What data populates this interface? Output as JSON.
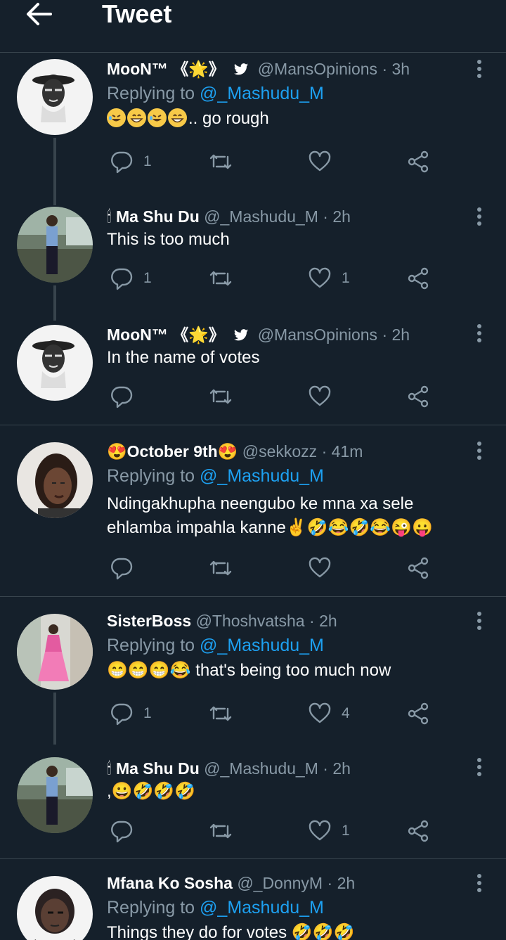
{
  "header": {
    "title": "Tweet"
  },
  "tweets": [
    {
      "name": "MooN™ 《🌟》",
      "handle": "@MansOpinions",
      "dot": "·",
      "time": "3h",
      "verified_bird": true,
      "replying_prefix": "Replying to ",
      "replying_to": "@_Mashudu_M",
      "text_suffix": ".. go rough",
      "emojis": [
        "rofl",
        "grin",
        "rofl",
        "grin"
      ],
      "reply_count": "1",
      "retweet_count": "",
      "like_count": ""
    },
    {
      "name_prefix": "🕯",
      "name": "Ma Shu Du",
      "handle": "@_Mashudu_M",
      "dot": "·",
      "time": "2h",
      "text": "This is too much",
      "reply_count": "1",
      "retweet_count": "",
      "like_count": "1"
    },
    {
      "name": "MooN™ 《🌟》",
      "handle": "@MansOpinions",
      "dot": "·",
      "time": "2h",
      "text": "In the name of votes",
      "reply_count": "",
      "retweet_count": "",
      "like_count": ""
    },
    {
      "name": "😍October 9th😍",
      "handle": "@sekkozz",
      "dot": "·",
      "time": "41m",
      "replying_prefix": "Replying to ",
      "replying_to": "@_Mashudu_M",
      "text_line1": "Ndingakhupha neengubo ke mna xa sele",
      "text_line2": "ehlamba impahla kanne✌🤣😂🤣😂😜😛",
      "reply_count": "",
      "retweet_count": "",
      "like_count": ""
    },
    {
      "name": "SisterBoss",
      "handle": "@Thoshvatsha",
      "dot": "·",
      "time": "2h",
      "replying_prefix": "Replying to ",
      "replying_to": "@_Mashudu_M",
      "text": "😁😁😁😂 that's being too much now",
      "reply_count": "1",
      "retweet_count": "",
      "like_count": "4"
    },
    {
      "name_prefix": "🕯",
      "name": "Ma Shu Du",
      "handle": "@_Mashudu_M",
      "dot": "·",
      "time": "2h",
      "text": ",😀🤣🤣🤣",
      "reply_count": "",
      "retweet_count": "",
      "like_count": "1"
    },
    {
      "name": "Mfana Ko Sosha",
      "handle": "@_DonnyM",
      "dot": "·",
      "time": "2h",
      "replying_prefix": "Replying to ",
      "replying_to": "@_Mashudu_M",
      "text": "Things they do for votes 🤣🤣🤣"
    }
  ],
  "colors": {
    "background": "#15202b",
    "muted": "#8899a6",
    "link": "#1da1f2",
    "divider": "#38444d"
  }
}
